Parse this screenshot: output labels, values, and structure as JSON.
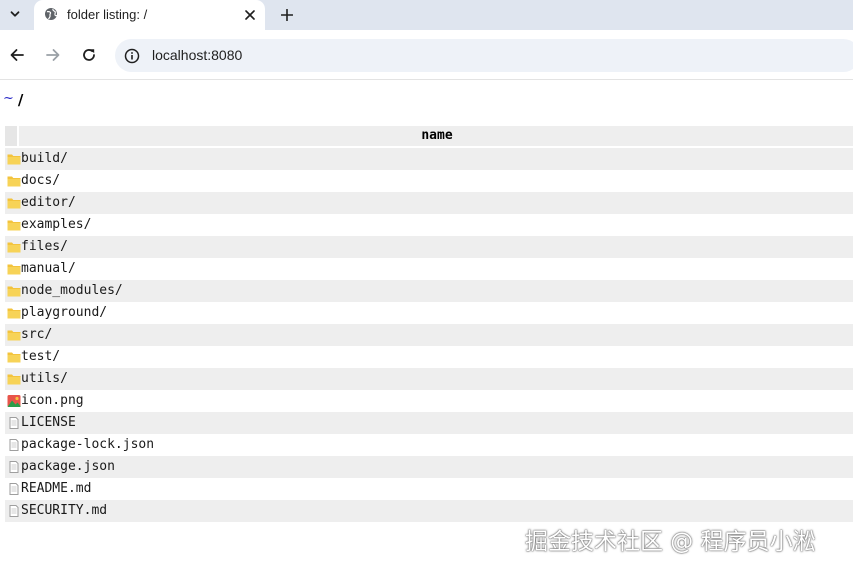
{
  "browser": {
    "tab": {
      "title": "folder listing: /",
      "favicon": "globe-icon"
    },
    "address": {
      "url": "localhost:8080"
    },
    "icons": [
      "chevron-down-icon",
      "close-icon",
      "plus-icon",
      "back-arrow-icon",
      "forward-arrow-icon",
      "reload-icon",
      "info-icon"
    ]
  },
  "page": {
    "breadcrumb": {
      "home": "~",
      "current": "/"
    },
    "table": {
      "header": "name",
      "rows": [
        {
          "name": "build/",
          "type": "folder"
        },
        {
          "name": "docs/",
          "type": "folder"
        },
        {
          "name": "editor/",
          "type": "folder"
        },
        {
          "name": "examples/",
          "type": "folder"
        },
        {
          "name": "files/",
          "type": "folder"
        },
        {
          "name": "manual/",
          "type": "folder"
        },
        {
          "name": "node_modules/",
          "type": "folder"
        },
        {
          "name": "playground/",
          "type": "folder"
        },
        {
          "name": "src/",
          "type": "folder"
        },
        {
          "name": "test/",
          "type": "folder"
        },
        {
          "name": "utils/",
          "type": "folder"
        },
        {
          "name": "icon.png",
          "type": "image"
        },
        {
          "name": "LICENSE",
          "type": "file"
        },
        {
          "name": "package-lock.json",
          "type": "file"
        },
        {
          "name": "package.json",
          "type": "file"
        },
        {
          "name": "README.md",
          "type": "file"
        },
        {
          "name": "SECURITY.md",
          "type": "file"
        }
      ]
    }
  },
  "watermark": "掘金技术社区 @ 程序员小淞",
  "colors": {
    "tabstrip": "#dfe5ef",
    "omnibox": "#eef2f8",
    "row_alt": "#eeeeee",
    "folder": "#f3c33c",
    "home_link": "#2b2bc8"
  }
}
